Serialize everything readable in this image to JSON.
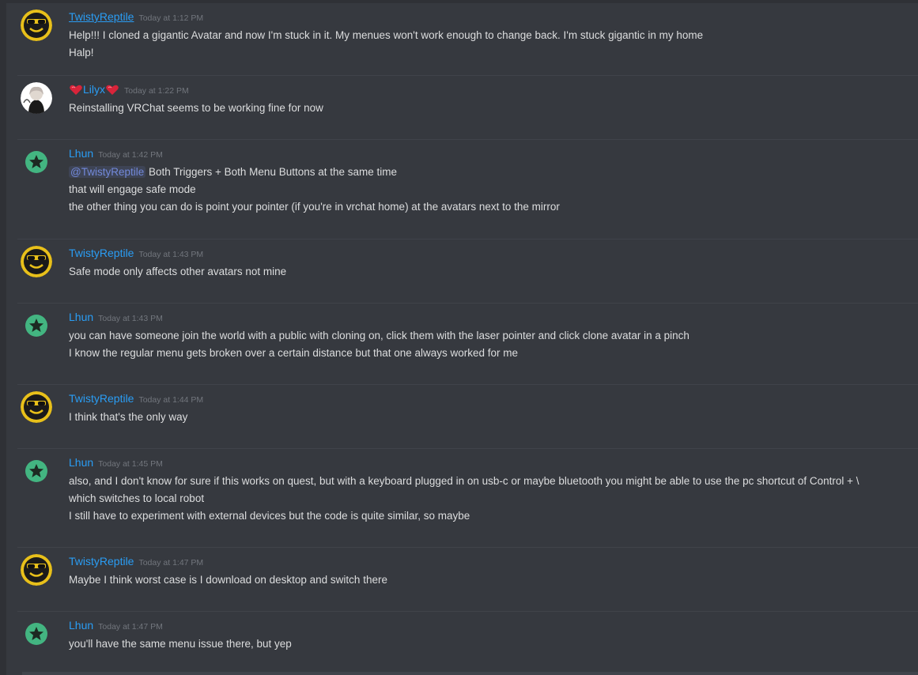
{
  "messages": [
    {
      "author": "TwistyReptile",
      "time": "Today at 1:12 PM",
      "avatar": "sunglasses-face-icon",
      "lines": [
        "Help!!! I cloned a gigantic Avatar and now I'm stuck in it.   My menues won't work enough to change back.  I'm stuck gigantic in my home",
        "Halp!"
      ]
    },
    {
      "author": "Lilyx",
      "time": "Today at 1:22 PM",
      "avatar": "anime-girl-avatar",
      "lines": [
        "Reinstalling VRChat seems to be working fine for now"
      ]
    },
    {
      "author": "Lhun",
      "time": "Today at 1:42 PM",
      "avatar": "star-icon",
      "mention": "@TwistyReptile",
      "lines": [
        " Both Triggers + Both Menu Buttons at the same time",
        "that will engage safe mode",
        "the other thing you can do is point your pointer (if you're in vrchat home) at the avatars next to the mirror"
      ]
    },
    {
      "author": "TwistyReptile",
      "time": "Today at 1:43 PM",
      "avatar": "sunglasses-face-icon",
      "lines": [
        "Safe mode only affects other avatars not mine"
      ]
    },
    {
      "author": "Lhun",
      "time": "Today at 1:43 PM",
      "avatar": "star-icon",
      "lines": [
        "you can have someone join the world with a public with cloning on, click them with the laser pointer and click clone avatar in a pinch",
        "I know the regular menu gets broken over a certain distance but that one always worked for me"
      ]
    },
    {
      "author": "TwistyReptile",
      "time": "Today at 1:44 PM",
      "avatar": "sunglasses-face-icon",
      "lines": [
        "I think that's the only way"
      ]
    },
    {
      "author": "Lhun",
      "time": "Today at 1:45 PM",
      "avatar": "star-icon",
      "lines": [
        "also, and I don't know for sure if this works on quest, but with a keyboard plugged in on usb-c or maybe bluetooth you might be able to use the pc shortcut of Control + \\",
        "which switches to local robot",
        "I still have to experiment with external devices but the code is quite similar, so maybe"
      ]
    },
    {
      "author": "TwistyReptile",
      "time": "Today at 1:47 PM",
      "avatar": "sunglasses-face-icon",
      "lines": [
        "Maybe I think worst case is I download on desktop and switch there"
      ]
    },
    {
      "author": "Lhun",
      "time": "Today at 1:47 PM",
      "avatar": "star-icon",
      "lines": [
        "you'll have the same menu issue there, but yep"
      ]
    }
  ],
  "colors": {
    "background": "#36393f",
    "username": "#2a9df4",
    "timestamp": "#72767d",
    "mention": "#7289da",
    "twisty_avatar": "#e8c01a",
    "lhun_avatar": "#43b581"
  }
}
